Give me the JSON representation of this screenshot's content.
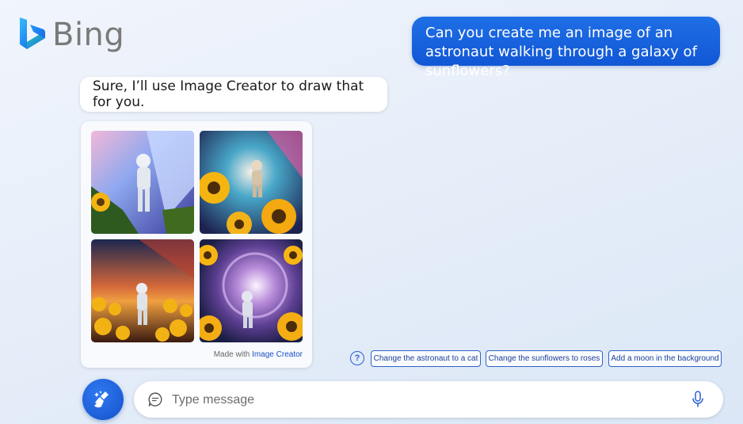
{
  "app": {
    "name": "Bing"
  },
  "conversation": {
    "user_message": "Can you create me an image of an astronaut walking through a galaxy of sunflowers?",
    "bot_message": "Sure, I’ll use Image Creator to draw that for you."
  },
  "image_card": {
    "made_with_prefix": "Made with",
    "made_with_link": "Image Creator",
    "images": [
      "astronaut-image-1",
      "astronaut-image-2",
      "astronaut-image-3",
      "astronaut-image-4"
    ]
  },
  "suggestions": {
    "help_label": "?",
    "chips": [
      "Change the astronaut to a cat",
      "Change the sunflowers to roses",
      "Add a moon in the background"
    ]
  },
  "composer": {
    "placeholder": "Type message"
  },
  "colors": {
    "accent": "#1157d6",
    "chip_border": "#2f62c8",
    "logo_gray": "#7a7a7a"
  },
  "icons": [
    "bing-logo-icon",
    "chat-bubble-icon",
    "microphone-icon",
    "broom-sparkle-icon",
    "help-icon"
  ]
}
